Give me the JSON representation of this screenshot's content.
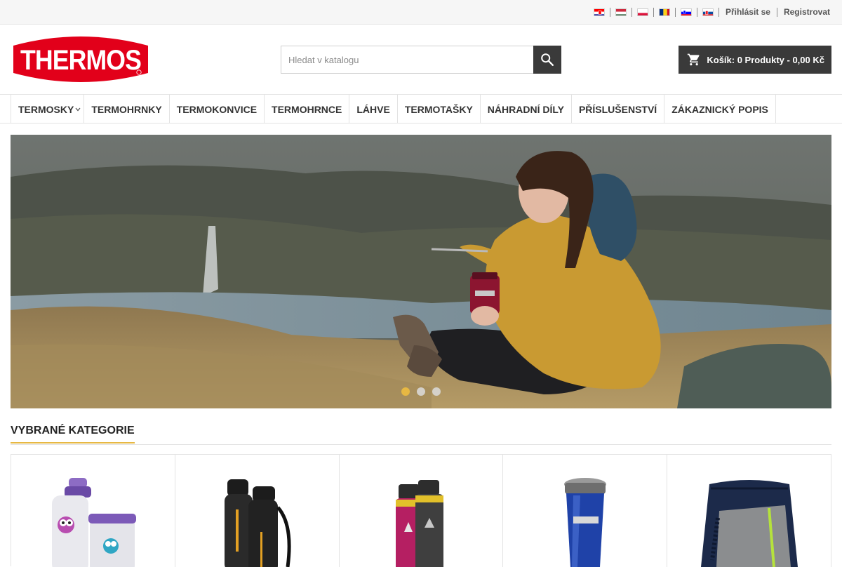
{
  "topbar": {
    "flags": [
      {
        "name": "croatia-flag",
        "colors": [
          "#ff0000",
          "#ffffff",
          "#171796"
        ]
      },
      {
        "name": "hungary-flag",
        "colors": [
          "#cd2a3e",
          "#ffffff",
          "#436f4d"
        ]
      },
      {
        "name": "poland-flag",
        "colors": [
          "#ffffff",
          "#dc143c"
        ]
      },
      {
        "name": "romania-flag",
        "colors": [
          "#002b7f",
          "#fcd116",
          "#ce1126"
        ]
      },
      {
        "name": "slovenia-flag",
        "colors": [
          "#ffffff",
          "#0000ff",
          "#ff0000"
        ]
      },
      {
        "name": "slovakia-flag",
        "colors": [
          "#ffffff",
          "#0b4ea2",
          "#ee1c25"
        ]
      }
    ],
    "login_label": "Přihlásit se",
    "register_label": "Registrovat"
  },
  "header": {
    "logo_text": "THERMOS",
    "logo_color": "#e2001a",
    "search": {
      "placeholder": "Hledat v katalogu"
    },
    "cart_label": "Košík: 0 Produkty - 0,00 Kč"
  },
  "nav": {
    "items": [
      {
        "label": "TERMOSKY",
        "has_dropdown": true
      },
      {
        "label": "TERMOHRNKY"
      },
      {
        "label": "TERMOKONVICE"
      },
      {
        "label": "TERMOHRNCE"
      },
      {
        "label": "LÁHVE"
      },
      {
        "label": "TERMOTAŠKY"
      },
      {
        "label": "NÁHRADNÍ DÍLY"
      },
      {
        "label": "PŘÍSLUŠENSTVÍ"
      },
      {
        "label": "ZÁKAZNICKÝ POPIS"
      }
    ]
  },
  "slider": {
    "slide_count": 3,
    "active_index": 0,
    "accent_color": "#e7b843"
  },
  "categories": {
    "title": "VYBRANÉ KATEGORIE",
    "items": [
      {
        "name": "kids-owl-bottle-image"
      },
      {
        "name": "black-sport-bottle-image"
      },
      {
        "name": "mountain-flask-image"
      },
      {
        "name": "blue-travel-mug-image"
      },
      {
        "name": "cooler-bag-image"
      }
    ]
  }
}
